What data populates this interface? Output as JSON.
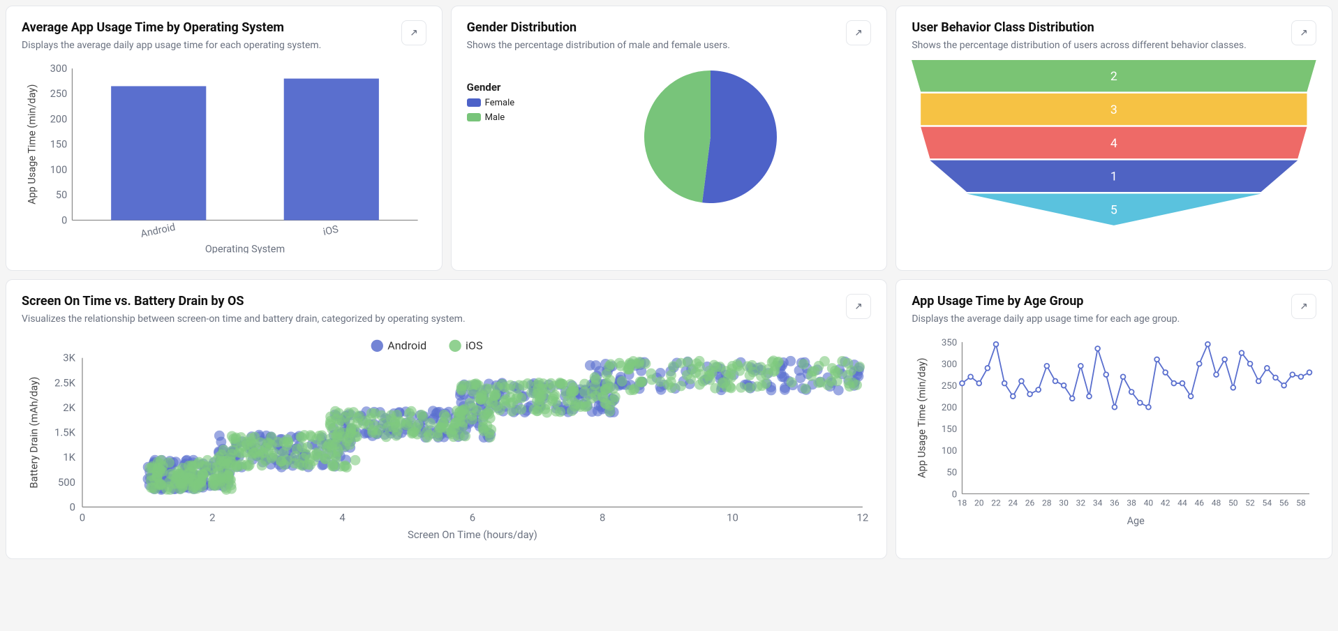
{
  "cards": {
    "avg_os": {
      "title": "Average App Usage Time by Operating System",
      "subtitle": "Displays the average daily app usage time for each operating system.",
      "xlabel": "Operating System",
      "ylabel": "App Usage Time (min/day)"
    },
    "gender": {
      "title": "Gender Distribution",
      "subtitle": "Shows the percentage distribution of male and female users.",
      "legend_title": "Gender",
      "legend_female": "Female",
      "legend_male": "Male"
    },
    "behavior": {
      "title": "User Behavior Class Distribution",
      "subtitle": "Shows the percentage distribution of users across different behavior classes."
    },
    "scatter": {
      "title": "Screen On Time vs. Battery Drain by OS",
      "subtitle": "Visualizes the relationship between screen-on time and battery drain, categorized by operating system.",
      "legend_android": "Android",
      "legend_ios": "iOS",
      "xlabel": "Screen On Time (hours/day)",
      "ylabel": "Battery Drain (mAh/day)"
    },
    "age": {
      "title": "App Usage Time by Age Group",
      "subtitle": "Displays the average daily app usage time for each age group.",
      "xlabel": "Age",
      "ylabel": "App Usage Time (min/day)"
    }
  },
  "chart_data": [
    {
      "id": "avg_os",
      "type": "bar",
      "categories": [
        "Android",
        "iOS"
      ],
      "values": [
        265,
        280
      ],
      "ylim": [
        0,
        300
      ],
      "yticks": [
        0,
        50,
        100,
        150,
        200,
        250,
        300
      ],
      "xlabel": "Operating System",
      "ylabel": "App Usage Time (min/day)",
      "color": "#5a6fce"
    },
    {
      "id": "gender",
      "type": "pie",
      "slices": [
        {
          "name": "Female",
          "value": 52,
          "color": "#4d62c8"
        },
        {
          "name": "Male",
          "value": 48,
          "color": "#78c47a"
        }
      ]
    },
    {
      "id": "behavior",
      "type": "funnel",
      "rows": [
        {
          "label": "2",
          "value": 22,
          "color": "#7ac474"
        },
        {
          "label": "3",
          "value": 21,
          "color": "#f6c244"
        },
        {
          "label": "4",
          "value": 21,
          "color": "#ee6a67"
        },
        {
          "label": "1",
          "value": 20,
          "color": "#4f63c3"
        },
        {
          "label": "5",
          "value": 16,
          "color": "#5ac2de"
        }
      ]
    },
    {
      "id": "scatter",
      "type": "scatter",
      "xlabel": "Screen On Time (hours/day)",
      "ylabel": "Battery Drain (mAh/day)",
      "xlim": [
        0,
        12
      ],
      "ylim": [
        0,
        3000
      ],
      "xticks": [
        0,
        2,
        4,
        6,
        8,
        10,
        12
      ],
      "yticks": [
        0,
        500,
        1000,
        1500,
        2000,
        2500,
        3000
      ],
      "ytick_labels": [
        "0",
        "500",
        "1K",
        "1.5K",
        "2K",
        "2.5K",
        "3K"
      ],
      "series": [
        {
          "name": "Android",
          "color": "#5a6fce",
          "approx_bands": [
            {
              "x": [
                1,
                2.3
              ],
              "y": [
                350,
                950
              ]
            },
            {
              "x": [
                2.1,
                4.2
              ],
              "y": [
                800,
                1450
              ]
            },
            {
              "x": [
                3.8,
                6.3
              ],
              "y": [
                1400,
                1950
              ]
            },
            {
              "x": [
                5.8,
                8.2
              ],
              "y": [
                1900,
                2500
              ]
            },
            {
              "x": [
                7.8,
                12
              ],
              "y": [
                2350,
                2950
              ]
            }
          ]
        },
        {
          "name": "iOS",
          "color": "#7ec97e",
          "approx_bands": [
            {
              "x": [
                1,
                2.3
              ],
              "y": [
                350,
                950
              ]
            },
            {
              "x": [
                2.1,
                4.2
              ],
              "y": [
                800,
                1450
              ]
            },
            {
              "x": [
                3.8,
                6.3
              ],
              "y": [
                1400,
                1950
              ]
            },
            {
              "x": [
                5.8,
                8.2
              ],
              "y": [
                1900,
                2500
              ]
            },
            {
              "x": [
                7.8,
                12
              ],
              "y": [
                2350,
                2950
              ]
            }
          ]
        }
      ]
    },
    {
      "id": "age",
      "type": "line",
      "xlabel": "Age",
      "ylabel": "App Usage Time (min/day)",
      "ylim": [
        0,
        350
      ],
      "yticks": [
        0,
        50,
        100,
        150,
        200,
        250,
        300,
        350
      ],
      "xticks": [
        18,
        20,
        22,
        24,
        26,
        28,
        30,
        32,
        34,
        36,
        38,
        40,
        42,
        44,
        46,
        48,
        50,
        52,
        54,
        56,
        58
      ],
      "x": [
        18,
        19,
        20,
        21,
        22,
        23,
        24,
        25,
        26,
        27,
        28,
        29,
        30,
        31,
        32,
        33,
        34,
        35,
        36,
        37,
        38,
        39,
        40,
        41,
        42,
        43,
        44,
        45,
        46,
        47,
        48,
        49,
        50,
        51,
        52,
        53,
        54,
        55,
        56,
        57,
        58,
        59
      ],
      "values": [
        255,
        270,
        255,
        290,
        345,
        255,
        225,
        260,
        230,
        240,
        295,
        260,
        250,
        220,
        295,
        225,
        335,
        275,
        200,
        270,
        235,
        210,
        200,
        310,
        280,
        255,
        255,
        225,
        300,
        345,
        275,
        310,
        245,
        325,
        300,
        260,
        290,
        268,
        250,
        275,
        270,
        280
      ],
      "color": "#5a6fce"
    }
  ]
}
